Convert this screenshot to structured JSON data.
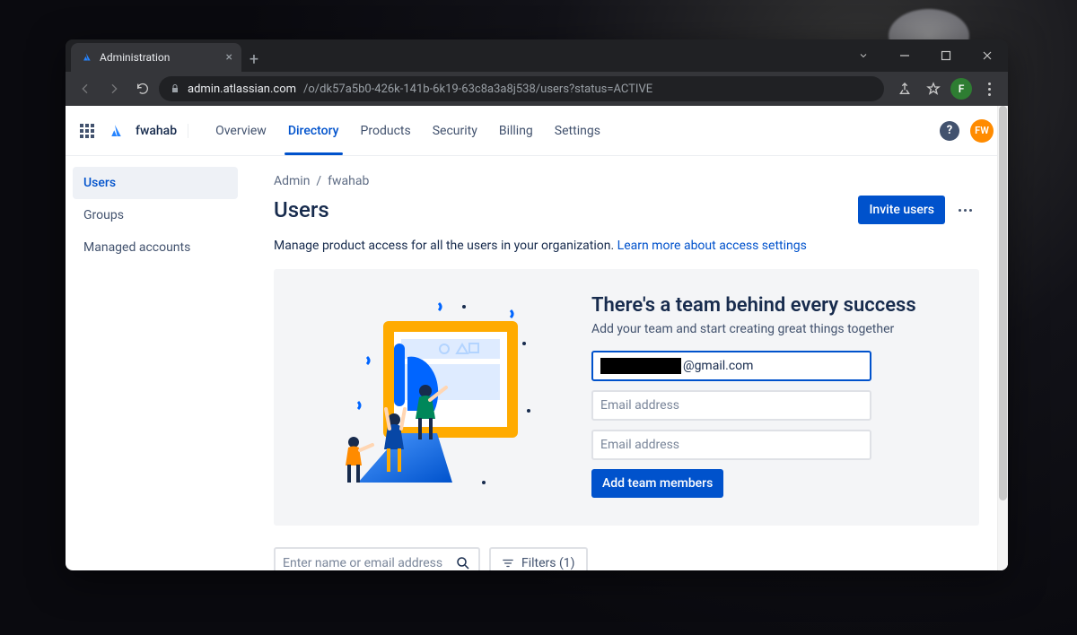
{
  "browser": {
    "tab_title": "Administration",
    "url_host": "admin.atlassian.com",
    "url_path": "/o/dk57a5b0-426k-141b-6k19-63c8a3a8j538/users?status=ACTIVE",
    "profile_initial": "F"
  },
  "appbar": {
    "org_name": "fwahab",
    "tabs": [
      "Overview",
      "Directory",
      "Products",
      "Security",
      "Billing",
      "Settings"
    ],
    "active_tab_index": 1,
    "avatar_initials": "FW"
  },
  "sidebar": {
    "items": [
      "Users",
      "Groups",
      "Managed accounts"
    ],
    "active_index": 0
  },
  "breadcrumb": {
    "root": "Admin",
    "leaf": "fwahab"
  },
  "page_title": "Users",
  "invite_button": "Invite users",
  "description_text": "Manage product access for all the users in your organization. ",
  "description_link": "Learn more about access settings",
  "panel": {
    "heading": "There's a team behind every success",
    "sub": "Add your team and start creating great things together",
    "email1_suffix": "@gmail.com",
    "placeholder": "Email address",
    "add_button": "Add team members"
  },
  "search_placeholder": "Enter name or email address",
  "filters_label": "Filters (1)"
}
